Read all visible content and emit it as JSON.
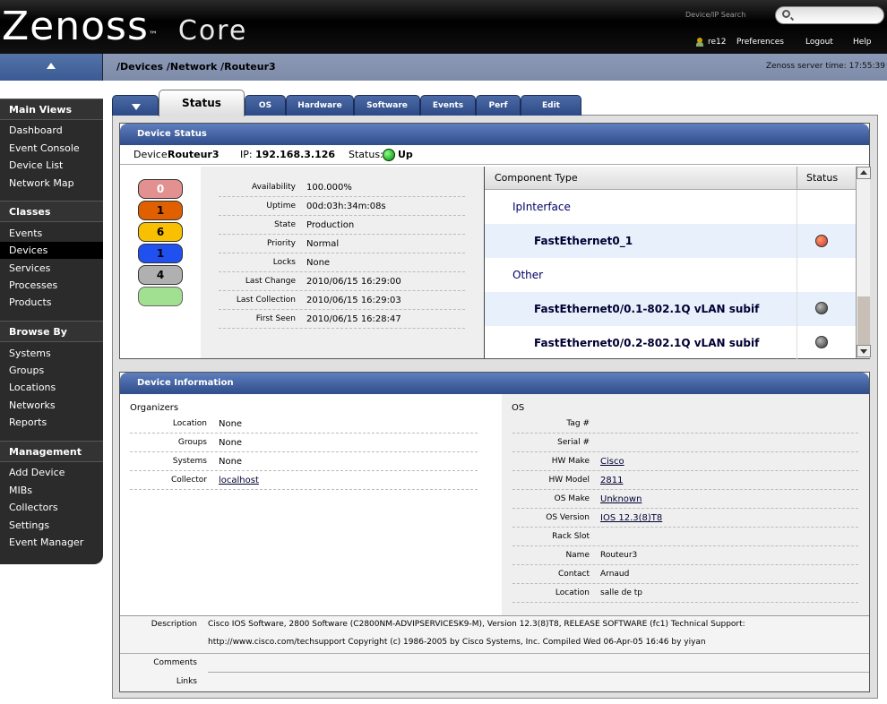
{
  "app": {
    "logo": "Zenoss",
    "logo_suffix": "Core",
    "trademark": "™"
  },
  "header": {
    "search_label": "Device/IP Search",
    "search_placeholder": "",
    "user": "re12",
    "preferences": "Preferences",
    "logout": "Logout",
    "help": "Help"
  },
  "breadcrumb": "/Devices /Network /Routeur3",
  "server_time": "Zenoss server time: 17:55:39",
  "sidebar": {
    "sections": [
      {
        "title": "Main Views",
        "items": [
          "Dashboard",
          "Event Console",
          "Device List",
          "Network Map"
        ]
      },
      {
        "title": "Classes",
        "items": [
          "Events",
          "Devices",
          "Services",
          "Processes",
          "Products"
        ]
      },
      {
        "title": "Browse By",
        "items": [
          "Systems",
          "Groups",
          "Locations",
          "Networks",
          "Reports"
        ]
      },
      {
        "title": "Management",
        "items": [
          "Add Device",
          "MIBs",
          "Collectors",
          "Settings",
          "Event Manager"
        ]
      }
    ],
    "active_item": "Devices"
  },
  "tabs": [
    "Status",
    "OS",
    "Hardware",
    "Software",
    "Events",
    "Perf",
    "Edit"
  ],
  "active_tab": "Status",
  "device_status": {
    "title": "Device Status",
    "device_label": "Device:",
    "device_name": "Routeur3",
    "ip_label": "IP:",
    "ip": "192.168.3.126",
    "status_label": "Status:",
    "status": "Up",
    "severities": [
      {
        "count": "0",
        "color": "#e29090"
      },
      {
        "count": "1",
        "color": "#e06000"
      },
      {
        "count": "6",
        "color": "#f8c000"
      },
      {
        "count": "1",
        "color": "#2050f0"
      },
      {
        "count": "4",
        "color": "#b0b0b0"
      },
      {
        "count": "",
        "color": "#a0e090"
      }
    ],
    "stats": [
      {
        "key": "Availability",
        "value": "100.000%"
      },
      {
        "key": "Uptime",
        "value": "00d:03h:34m:08s"
      },
      {
        "key": "State",
        "value": "Production"
      },
      {
        "key": "Priority",
        "value": "Normal"
      },
      {
        "key": "Locks",
        "value": "None"
      },
      {
        "key": "Last Change",
        "value": "2010/06/15 16:29:00"
      },
      {
        "key": "Last Collection",
        "value": "2010/06/15 16:29:03"
      },
      {
        "key": "First Seen",
        "value": "2010/06/15 16:28:47"
      }
    ],
    "component_table": {
      "col_type": "Component Type",
      "col_status": "Status",
      "rows": [
        {
          "label": "IpInterface",
          "group": true,
          "status": null
        },
        {
          "label": "FastEthernet0_1",
          "group": false,
          "status": "#e05a1a"
        },
        {
          "label": "Other",
          "group": true,
          "status": null
        },
        {
          "label": "FastEthernet0/0.1-802.1Q vLAN subif",
          "group": false,
          "status": "#555555"
        },
        {
          "label": "FastEthernet0/0.2-802.1Q vLAN subif",
          "group": false,
          "status": "#555555"
        }
      ]
    }
  },
  "device_info": {
    "title": "Device Information",
    "organizers_title": "Organizers",
    "organizers": [
      {
        "key": "Location",
        "value": "None",
        "link": false
      },
      {
        "key": "Groups",
        "value": "None",
        "link": false
      },
      {
        "key": "Systems",
        "value": "None",
        "link": false
      },
      {
        "key": "Collector",
        "value": "localhost",
        "link": true
      }
    ],
    "os_title": "OS",
    "os": [
      {
        "key": "Tag #",
        "value": "",
        "link": false
      },
      {
        "key": "Serial #",
        "value": "",
        "link": false
      },
      {
        "key": "HW Make",
        "value": "Cisco",
        "link": true
      },
      {
        "key": "HW Model",
        "value": "2811",
        "link": true
      },
      {
        "key": "OS Make",
        "value": "Unknown",
        "link": true
      },
      {
        "key": "OS Version",
        "value": "IOS 12.3(8)T8",
        "link": true
      },
      {
        "key": "Rack Slot",
        "value": "",
        "link": false
      },
      {
        "key": "Name",
        "value": "Routeur3",
        "link": false
      },
      {
        "key": "Contact",
        "value": "Arnaud",
        "link": false
      },
      {
        "key": "Location",
        "value": "salle de tp",
        "link": false
      }
    ],
    "description_label": "Description",
    "description_line1": "Cisco IOS Software, 2800 Software (C2800NM-ADVIPSERVICESK9-M), Version 12.3(8)T8, RELEASE SOFTWARE (fc1) Technical Support:",
    "description_line2": "http://www.cisco.com/techsupport Copyright (c) 1986-2005 by Cisco Systems, Inc. Compiled Wed 06-Apr-05 16:46 by yiyan",
    "comments_label": "Comments",
    "links_label": "Links"
  }
}
